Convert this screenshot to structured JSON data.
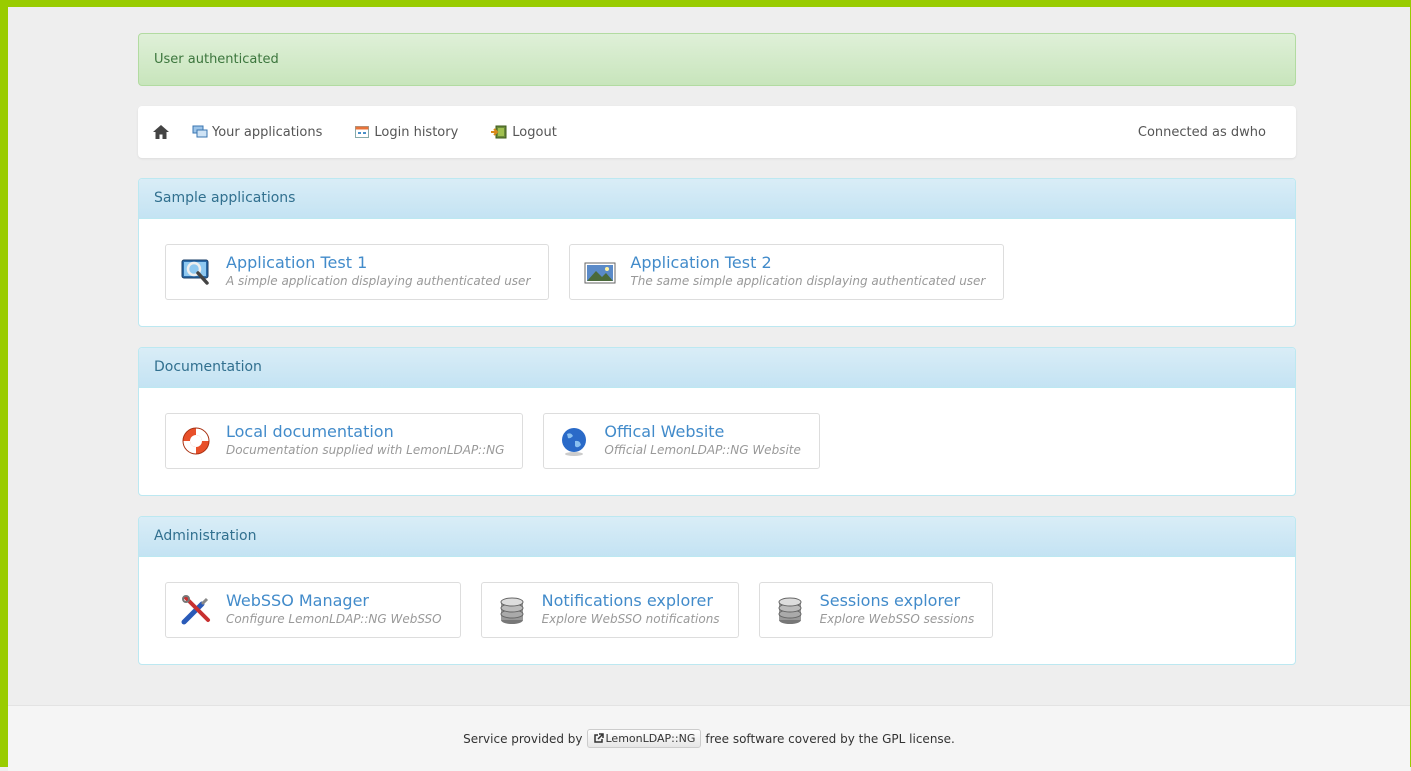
{
  "alert": {
    "text": "User authenticated"
  },
  "nav": {
    "home_icon": "home-icon",
    "items": [
      {
        "label": "Your applications",
        "icon": "applications-icon"
      },
      {
        "label": "Login history",
        "icon": "calendar-icon"
      },
      {
        "label": "Logout",
        "icon": "logout-icon"
      }
    ],
    "connected": "Connected as dwho"
  },
  "panels": [
    {
      "title": "Sample applications",
      "apps": [
        {
          "title": "Application Test 1",
          "desc": "A simple application displaying authenticated user",
          "icon": "magnifier-monitor-icon"
        },
        {
          "title": "Application Test 2",
          "desc": "The same simple application displaying authenticated user",
          "icon": "landscape-image-icon"
        }
      ]
    },
    {
      "title": "Documentation",
      "apps": [
        {
          "title": "Local documentation",
          "desc": "Documentation supplied with LemonLDAP::NG",
          "icon": "lifebuoy-icon"
        },
        {
          "title": "Offical Website",
          "desc": "Official LemonLDAP::NG Website",
          "icon": "globe-icon"
        }
      ]
    },
    {
      "title": "Administration",
      "apps": [
        {
          "title": "WebSSO Manager",
          "desc": "Configure LemonLDAP::NG WebSSO",
          "icon": "tools-icon"
        },
        {
          "title": "Notifications explorer",
          "desc": "Explore WebSSO notifications",
          "icon": "database-icon"
        },
        {
          "title": "Sessions explorer",
          "desc": "Explore WebSSO sessions",
          "icon": "database-icon"
        }
      ]
    }
  ],
  "footer": {
    "prefix": "Service provided by",
    "link": "LemonLDAP::NG",
    "suffix": "free software covered by the GPL license."
  },
  "colors": {
    "frame_border": "#99cc00",
    "alert_bg": "#dff0d8",
    "panel_heading_bg": "#d9edf7",
    "link": "#428bca"
  }
}
